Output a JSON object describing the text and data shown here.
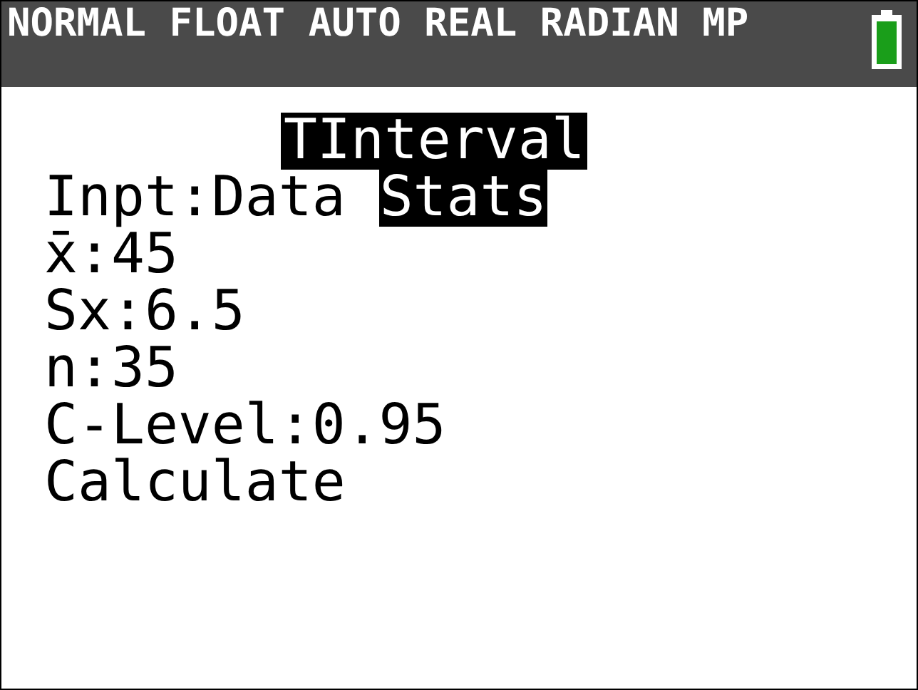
{
  "status_bar": {
    "modes": "NORMAL FLOAT AUTO REAL RADIAN MP"
  },
  "title": "TInterval",
  "input": {
    "label": "Inpt:",
    "options": [
      {
        "label": "Data",
        "selected": false
      },
      {
        "label": "Stats",
        "selected": true
      }
    ]
  },
  "lines": [
    "x̄:45",
    "Sx:6.5",
    "n:35",
    "C-Level:0.95"
  ],
  "action": "Calculate"
}
